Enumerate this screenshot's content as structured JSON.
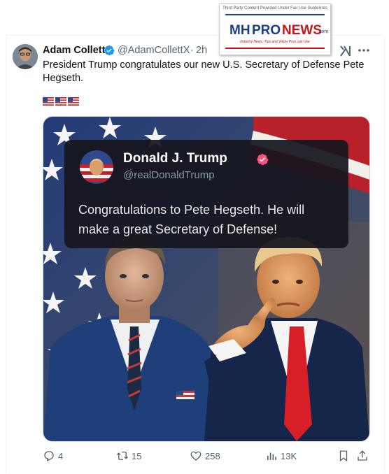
{
  "watermark": {
    "caption": "Third Party Content Provided Under Fair Use Guidelines",
    "logo_mh": "MH",
    "logo_pro": "PRO",
    "logo_news": "NEWS",
    "logo_com": ".com",
    "tagline": "Industry News, Tips and Views Pros can Use"
  },
  "tweet": {
    "author_name": "Adam Collett",
    "handle": "@AdamCollettX",
    "separator": "·",
    "time": "2h",
    "text": "President Trump congratulates our new U.S. Secretary of Defense Pete Hegseth.",
    "flags_count": 3
  },
  "embedded_post": {
    "name": "Donald J. Trump",
    "handle": "@realDonaldTrump",
    "text": "Congratulations to Pete Hegseth. He will make a great Secretary of Defense!"
  },
  "actions": {
    "replies": "4",
    "reposts": "15",
    "likes": "258",
    "views": "13K"
  },
  "colors": {
    "verified": "#1d9bf0",
    "text_secondary": "#536471",
    "card_badge": "#f4547c",
    "tie": "#d81e27",
    "suit": "#1f3f7a"
  },
  "icons": [
    "verified-badge-icon",
    "grok-icon",
    "more-icon",
    "reply-icon",
    "repost-icon",
    "like-icon",
    "views-icon",
    "bookmark-icon",
    "share-icon"
  ]
}
